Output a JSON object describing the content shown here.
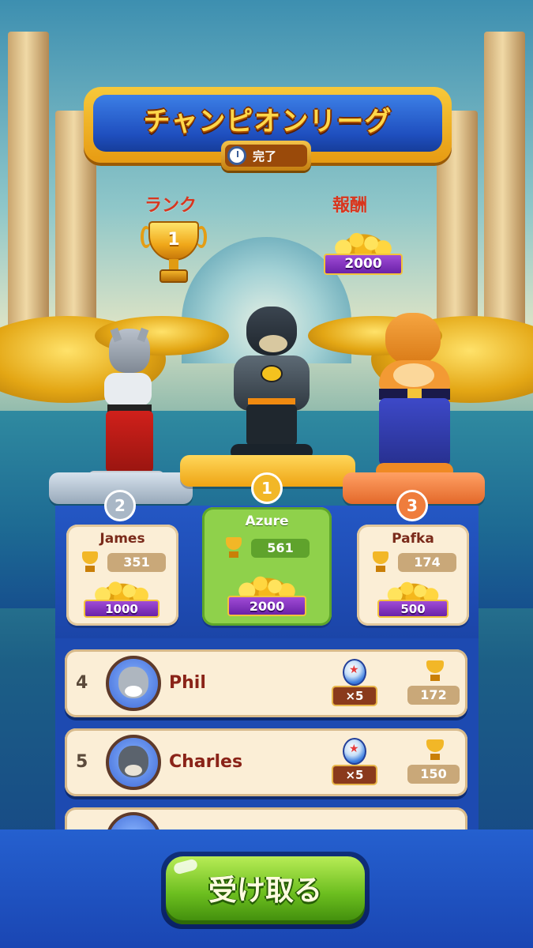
{
  "header": {
    "title": "チャンピオンリーグ",
    "status": "完了"
  },
  "summary": {
    "rank_label": "ランク",
    "rank_value": "1",
    "reward_label": "報酬",
    "reward_value": "2000"
  },
  "podium": [
    {
      "place": "2",
      "name": "James",
      "trophies": "351",
      "reward": "1000",
      "color": "#9fb3c8"
    },
    {
      "place": "1",
      "name": "Azure",
      "trophies": "561",
      "reward": "2000",
      "color": "#f2b727"
    },
    {
      "place": "3",
      "name": "Pafka",
      "trophies": "174",
      "reward": "500",
      "color": "#ef7d3c"
    }
  ],
  "list": [
    {
      "rank": "4",
      "name": "Phil",
      "booster": "×5",
      "trophies": "172"
    },
    {
      "rank": "5",
      "name": "Charles",
      "booster": "×5",
      "trophies": "150"
    }
  ],
  "button": {
    "claim": "受け取る"
  },
  "icons": [
    "clock-icon",
    "trophy-icon",
    "coin-stack-icon",
    "medal-icon",
    "booster-ball-icon"
  ],
  "colors": {
    "accent_green": "#6cbe1f",
    "banner_blue": "#1f4fbf",
    "gold": "#f2b727",
    "name_red": "#8a2318"
  }
}
